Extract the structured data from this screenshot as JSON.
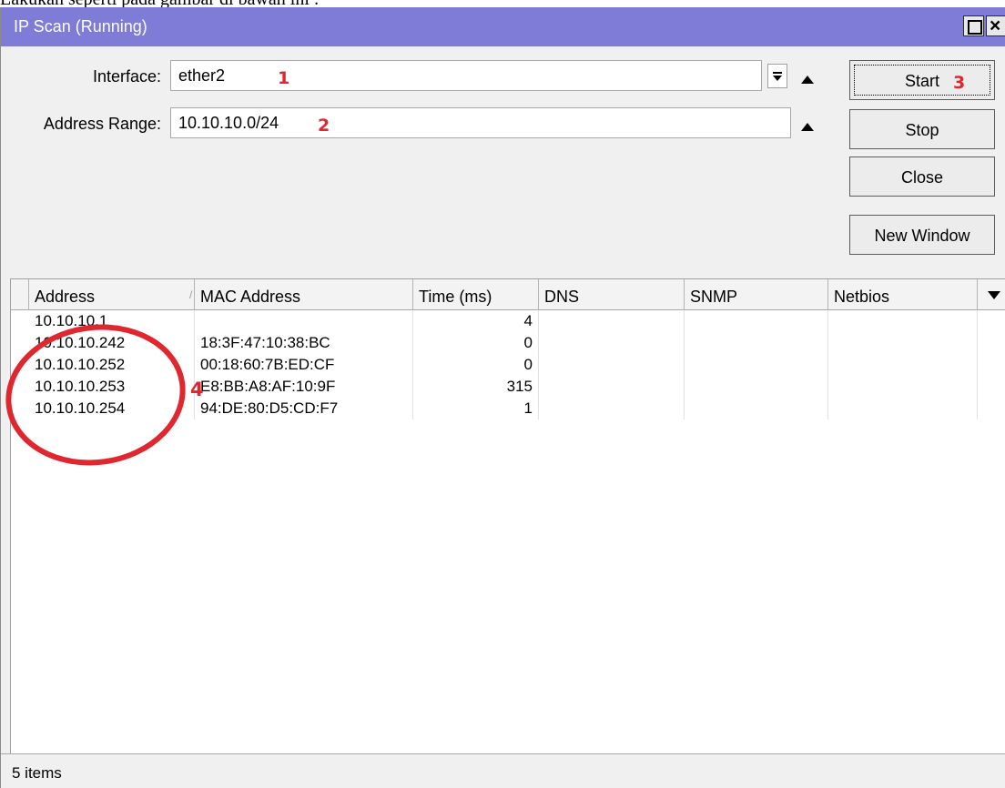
{
  "caption": "Lakukan seperti pada gambar di bawah ini :",
  "window": {
    "title": "IP Scan (Running)",
    "restore_icon": "restore-icon",
    "close_icon": "close-icon"
  },
  "form": {
    "interface_label": "Interface:",
    "interface_value": "ether2",
    "address_range_label": "Address Range:",
    "address_range_value": "10.10.10.0/24"
  },
  "buttons": {
    "start": "Start",
    "stop": "Stop",
    "close": "Close",
    "new_window": "New Window"
  },
  "annotations": {
    "n1": "1",
    "n2": "2",
    "n3": "3",
    "n4": "4",
    "color": "#e0262e"
  },
  "table": {
    "columns": [
      "Address",
      "MAC Address",
      "Time (ms)",
      "DNS",
      "SNMP",
      "Netbios"
    ],
    "sort_indicator": "/",
    "rows": [
      {
        "address": "10.10.10.1",
        "mac": "",
        "time": "4",
        "dns": "",
        "snmp": "",
        "netbios": ""
      },
      {
        "address": "10.10.10.242",
        "mac": "18:3F:47:10:38:BC",
        "time": "0",
        "dns": "",
        "snmp": "",
        "netbios": ""
      },
      {
        "address": "10.10.10.252",
        "mac": "00:18:60:7B:ED:CF",
        "time": "0",
        "dns": "",
        "snmp": "",
        "netbios": ""
      },
      {
        "address": "10.10.10.253",
        "mac": "E8:BB:A8:AF:10:9F",
        "time": "315",
        "dns": "",
        "snmp": "",
        "netbios": ""
      },
      {
        "address": "10.10.10.254",
        "mac": "94:DE:80:D5:CD:F7",
        "time": "1",
        "dns": "",
        "snmp": "",
        "netbios": ""
      }
    ]
  },
  "status": "5 items",
  "colors": {
    "titlebar": "#7e7cd6",
    "window_bg": "#f0f0f0"
  }
}
